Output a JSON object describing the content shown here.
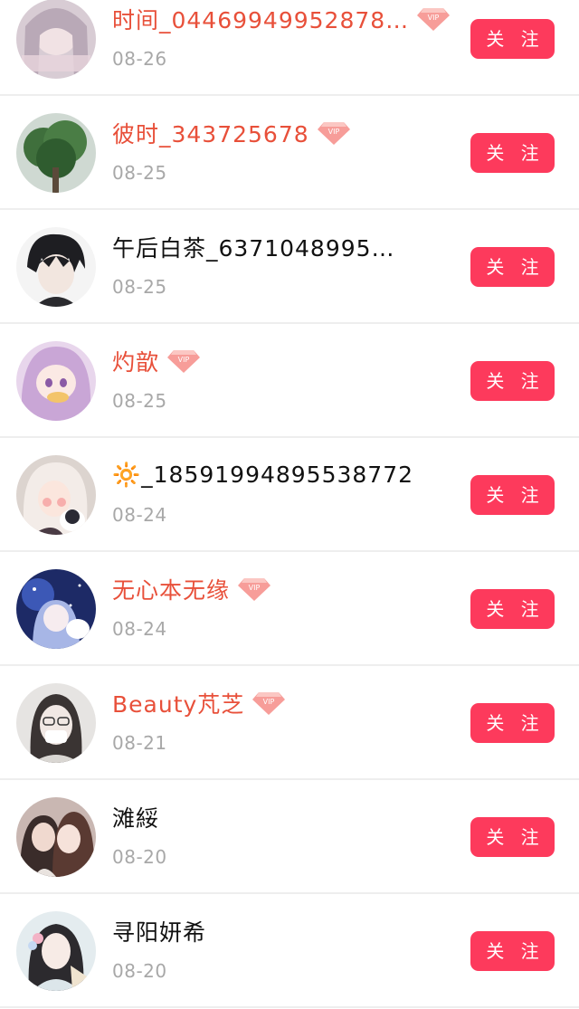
{
  "follow_label": "关 注",
  "vip_badge_text": "VIP",
  "users": [
    {
      "name": "时间_04469949952878…",
      "date": "08-26",
      "vip": true
    },
    {
      "name": "彼时_343725678",
      "date": "08-25",
      "vip": true
    },
    {
      "name": "午后白茶_6371048995…",
      "date": "08-25",
      "vip": false
    },
    {
      "name": "灼歆",
      "date": "08-25",
      "vip": true
    },
    {
      "name": "🔆_18591994895538772",
      "date": "08-24",
      "vip": false
    },
    {
      "name": "无心本无缘",
      "date": "08-24",
      "vip": true
    },
    {
      "name": "Beauty芃芝",
      "date": "08-21",
      "vip": true
    },
    {
      "name": "滩綏",
      "date": "08-20",
      "vip": false
    },
    {
      "name": "寻阳妍希",
      "date": "08-20",
      "vip": false
    }
  ]
}
